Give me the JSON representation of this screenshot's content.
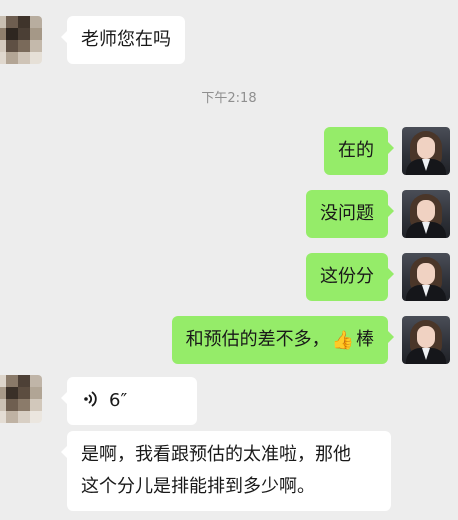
{
  "timestamp": "下午2:18",
  "messages": {
    "m1": {
      "text": "老师您在吗",
      "side": "incoming"
    },
    "m2": {
      "text": "在的",
      "side": "outgoing"
    },
    "m3": {
      "text": "没问题",
      "side": "outgoing"
    },
    "m4": {
      "text": "这份分",
      "side": "outgoing"
    },
    "m5": {
      "before_emoji": "和预估的差不多，",
      "emoji": "👍",
      "after_emoji": "棒",
      "side": "outgoing"
    },
    "m6": {
      "duration": "6″",
      "type": "voice",
      "side": "incoming"
    },
    "m7": {
      "line1": "是啊，我看跟预估的太准啦，那他",
      "line2": "这个分儿是排能排到多少啊。",
      "side": "incoming"
    }
  },
  "colors": {
    "background": "#ededed",
    "outgoing_bubble": "#95ec69",
    "incoming_bubble": "#ffffff",
    "timestamp": "#8f8f8f"
  },
  "icons": {
    "voice": "voice-wave-icon",
    "emoji": "thumbs-up-icon"
  }
}
